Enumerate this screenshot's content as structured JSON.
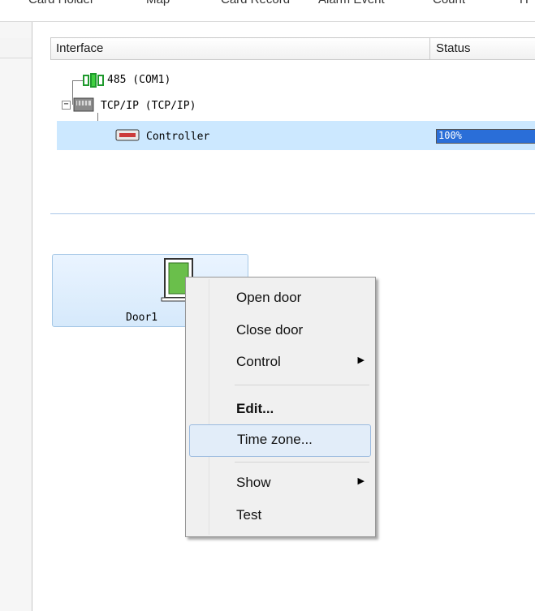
{
  "menubar": {
    "items": [
      "Card Holder",
      "Map",
      "Card Record",
      "Alarm Event",
      "Count",
      "H"
    ]
  },
  "grid": {
    "col_interface": "Interface",
    "col_status": "Status",
    "rows": {
      "com": "485 (COM1)",
      "tcpip": "TCP/IP (TCP/IP)",
      "controller": "Controller",
      "controller_progress": 1.0,
      "controller_progress_text": "100%"
    }
  },
  "door": {
    "label": "Door1",
    "icon": "door-icon",
    "color": "#6abf4b"
  },
  "context_menu": {
    "open_door": "Open door",
    "close_door": "Close door",
    "control": "Control",
    "edit": "Edit...",
    "time_zone": "Time zone...",
    "show": "Show",
    "test": "Test"
  },
  "colors": {
    "selection": "#cce8ff",
    "progress": "#2a6ed8",
    "hover": "#e2edf9"
  }
}
